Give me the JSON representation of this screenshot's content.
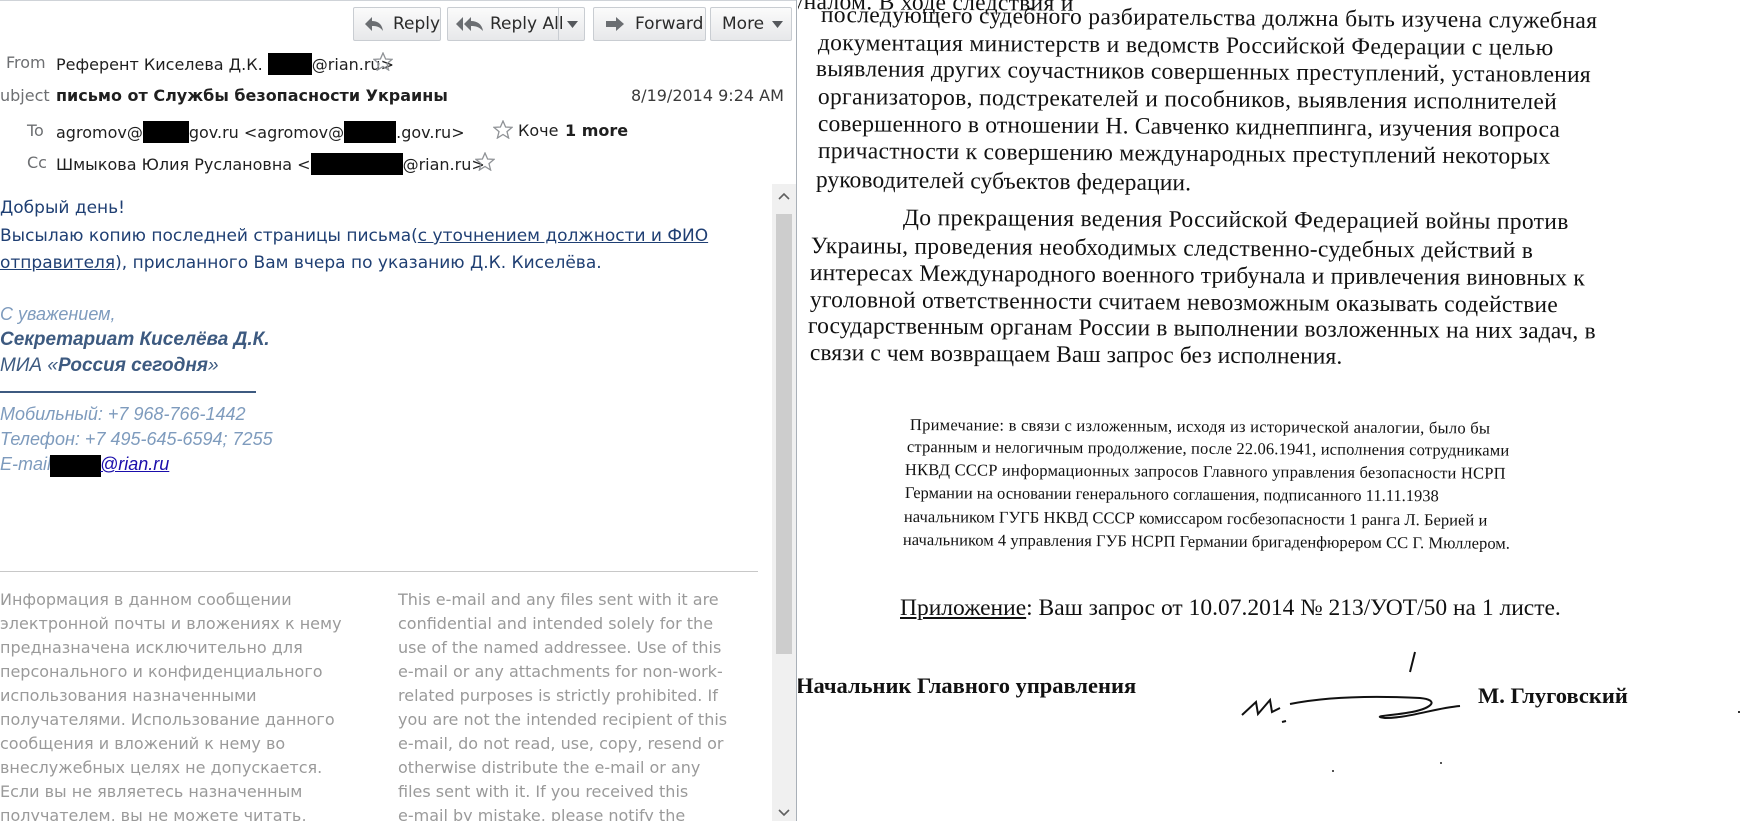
{
  "toolbar": {
    "reply": "Reply",
    "reply_all": "Reply All",
    "forward": "Forward",
    "more": "More"
  },
  "header": {
    "from_label": "From",
    "from_value_a": "Референт Киселева Д.К. ",
    "from_value_b": "@rian.ru>",
    "subject_label": "ubject",
    "subject_value": "письмо от Службы безопасности Украины",
    "date": "8/19/2014 9:24 AM",
    "to_label": "To",
    "to_a": "agromov@",
    "to_b": "gov.ru <agromov@",
    "to_c": ".gov.ru>",
    "to_d": "Коче",
    "to_more": "1 more",
    "cc_label": "Cc",
    "cc_a": "Шмыкова Юлия Руслановна <",
    "cc_b": "@rian.ru>"
  },
  "body": {
    "greeting": "Добрый день!",
    "line1_a": "Высылаю копию последней страницы письма(",
    "line1_link": "с уточнением должности и ФИО",
    "line2_link": "отправителя",
    "line2_b": "), присланного Вам вчера по указанию Д.К. Киселёва.",
    "regards": "С уважением,",
    "sig_name": "Секретариат Киселёва Д.К.",
    "sig_org_a": "МИА «",
    "sig_org_b": "Россия сегодня",
    "sig_org_c": "»",
    "mobile": "Мобильный: +7 968-766-1442",
    "phone": "Телефон: +7 495-645-6594; 7255",
    "email_label": "E-mail:",
    "email_domain": "@rian.ru"
  },
  "disclaimer_ru": [
    "Информация в данном сообщении",
    "электронной почты и вложениях к нему",
    "предназначена исключительно для",
    "персонального и конфиденциального",
    "использования назначенными",
    "получателями. Использование данного",
    "сообщения и вложений к нему во",
    "внеслужебных целях не допускается.",
    "Если вы не являетесь назначенным",
    "получателем, вы не можете читать,"
  ],
  "disclaimer_en": [
    "This e-mail and any files sent with it are",
    "confidential and intended solely for the",
    "use of the named addressee. Use of this",
    "e-mail or any attachments for non-work-",
    "related purposes is strictly prohibited. If",
    "you are not the intended recipient of this",
    "e-mail, do not read, use, copy, resend or",
    "otherwise distribute the e-mail or any",
    "files sent with it. If you received this",
    "e-mail by mistake, please notify the"
  ],
  "document": {
    "para1": [
      "                                                        судебным трибуналом. В ходе следствия и",
      "последующего судебного разбирательства должна быть изучена служебная",
      "документация министерств и ведомств Российской Федерации с целью",
      "выявления других соучастников совершенных преступлений, установления",
      "организаторов, подстрекателей и пособников, выявления исполнителей",
      "совершенного в отношении Н. Савченко киднеппинга, изучения вопроса",
      "причастности к совершению международных преступлений некоторых",
      "руководителей субъектов федерации."
    ],
    "para2": [
      "До прекращения ведения Российской Федерацией войны против",
      "Украины, проведения необходимых следственно-судебных действий в",
      "интересах Международного военного трибунала и привлечения виновных к",
      "уголовной ответственности считаем невозможным оказывать содействие",
      "государственным органам России в выполнении возложенных на них задач, в",
      "связи с чем возвращаем Ваш запрос без исполнения."
    ],
    "note": [
      "Примечание: в связи с изложенным, исходя из исторической аналогии, было бы",
      "странным и нелогичным продолжение, после 22.06.1941, исполнения сотрудниками",
      "НКВД СССР информационных запросов Главного управления безопасности НСРП",
      "Германии    на    основании    генерального    соглашения,    подписанного    11.11.1938",
      "начальником ГУГБ НКВД СССР комиссаром госбезопасности 1 ранга Л. Берией и",
      "начальником 4 управления ГУБ НСРП Германии бригаденфюрером СС Г. Мюллером."
    ],
    "appendix_label": "Приложение",
    "appendix_text": ": Ваш запрос от 10.07.2014 № 213/УОТ/50 на 1 листе.",
    "signer_title": "Начальник Главного управления",
    "signer_name": "М. Глуговский"
  }
}
